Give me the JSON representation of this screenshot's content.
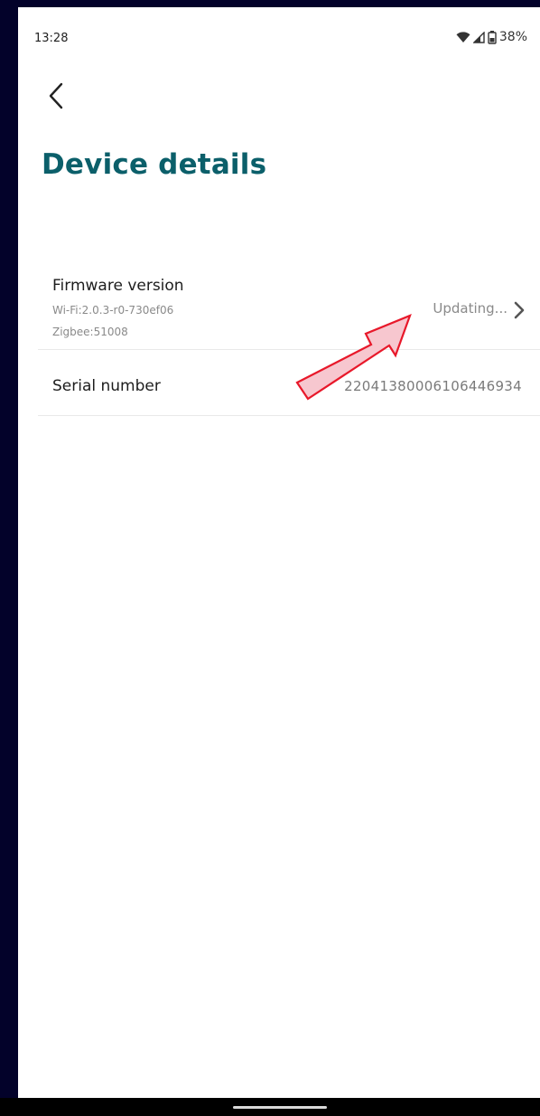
{
  "status_bar": {
    "time": "13:28",
    "battery": "38%",
    "icons": [
      "wifi-icon",
      "signal-icon",
      "battery-icon"
    ]
  },
  "header": {
    "back_icon": "chevron-left-icon",
    "title": "Device details"
  },
  "firmware": {
    "label": "Firmware version",
    "wifi": "Wi-Fi:2.0.3-r0-730ef06",
    "zigbee": "Zigbee:51008",
    "status": "Updating...",
    "chevron_icon": "chevron-right-icon"
  },
  "serial": {
    "label": "Serial number",
    "value": "22041380006106446934"
  },
  "colors": {
    "title": "#0b5f6a",
    "annotation_arrow": "#e8182a",
    "annotation_fill": "#f7c7cf"
  }
}
